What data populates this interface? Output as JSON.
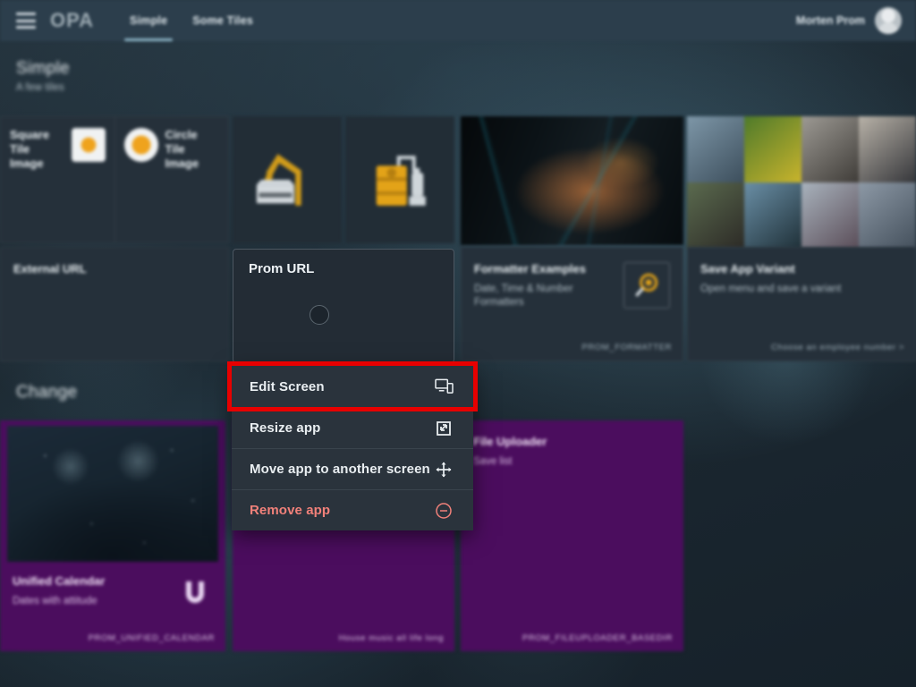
{
  "topbar": {
    "menu_icon": "hamburger-menu-icon",
    "brand": "OPA",
    "tabs": [
      {
        "label": "Simple",
        "active": true
      },
      {
        "label": "Some Tiles",
        "active": false
      }
    ],
    "user": {
      "name": "Morten Prom",
      "avatar_icon": "user-avatar-icon"
    }
  },
  "sections": [
    {
      "title": "Simple",
      "subtitle": "A few tiles"
    },
    {
      "title": "Change",
      "subtitle": ""
    }
  ],
  "tiles": {
    "square_tile": {
      "title": "Square Tile Image",
      "icon": "square-image-icon"
    },
    "circle_tile": {
      "title": "Circle Tile Image",
      "icon": "circle-image-icon"
    },
    "crane_tile": {
      "icon": "crane-excavator-icon"
    },
    "barrel_tile": {
      "icon": "oil-barrel-pump-icon"
    },
    "machine_photo": {
      "icon": "machinery-photo"
    },
    "collage_photo": {
      "icon": "people-collage-photo"
    },
    "external_url": {
      "title": "External URL"
    },
    "formatter": {
      "title": "Formatter Examples",
      "subtitle": "Date, Time & Number Formatters",
      "footer": "PROM_FORMATTER",
      "icon": "magnifier-gear-icon"
    },
    "save_variant": {
      "title": "Save App Variant",
      "subtitle": "Open menu and save a variant",
      "footer": "Choose an employee number >"
    },
    "unified_calendar": {
      "title": "Unified Calendar",
      "subtitle": "Dates with attitude",
      "footer": "PROM_UNIFIED_CALENDAR",
      "icon": "horseshoe-calendar-icon"
    },
    "music_card": {
      "footer": "House music all life long"
    },
    "file_uploader": {
      "title": "File Uploader",
      "subtitle": "Save list",
      "footer": "PROM_FILEUPLOADER_BASEDIR"
    }
  },
  "prom_card": {
    "title": "Prom URL",
    "control": "radio-circle"
  },
  "context_menu": {
    "items": [
      {
        "label": "Edit Screen",
        "icon": "edit-screen-icon",
        "danger": false,
        "highlighted": true
      },
      {
        "label": "Resize app",
        "icon": "resize-icon",
        "danger": false,
        "highlighted": false
      },
      {
        "label": "Move app to another screen",
        "icon": "move-arrows-icon",
        "danger": false,
        "highlighted": false
      },
      {
        "label": "Remove app",
        "icon": "remove-circle-icon",
        "danger": true,
        "highlighted": false
      }
    ]
  },
  "colors": {
    "highlight_red": "#e70000",
    "menu_bg": "#2a333c",
    "danger_text": "#f1817a",
    "purple_card": "#4b0d5e",
    "accent_amber": "#efa31d",
    "topbar_bg": "#2c3e4c"
  }
}
